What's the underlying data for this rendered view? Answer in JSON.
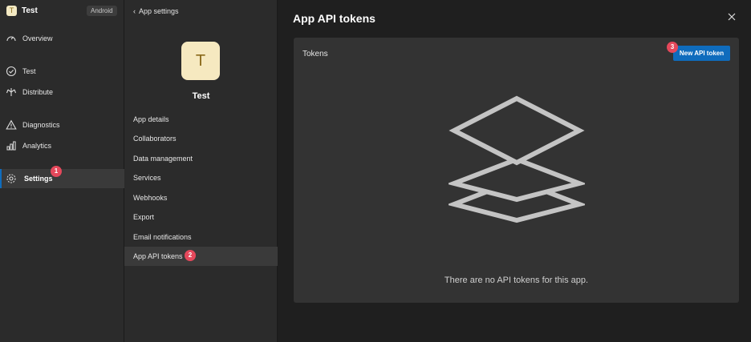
{
  "app": {
    "name": "Test",
    "initial": "T",
    "platform": "Android"
  },
  "nav": {
    "items": [
      {
        "label": "Overview",
        "icon": "gauge-icon"
      },
      {
        "label": "Test",
        "icon": "check-circle-icon"
      },
      {
        "label": "Distribute",
        "icon": "distribute-icon"
      },
      {
        "label": "Diagnostics",
        "icon": "warning-icon"
      },
      {
        "label": "Analytics",
        "icon": "bar-chart-icon"
      },
      {
        "label": "Settings",
        "icon": "gear-icon"
      }
    ],
    "active": "Settings"
  },
  "settings_column": {
    "back_label": "App settings",
    "app_title": "Test",
    "items": [
      "App details",
      "Collaborators",
      "Data management",
      "Services",
      "Webhooks",
      "Export",
      "Email notifications",
      "App API tokens"
    ],
    "active": "App API tokens"
  },
  "main": {
    "title": "App API tokens",
    "panel_title": "Tokens",
    "new_button_label": "New API token",
    "empty_message": "There are no API tokens for this app."
  },
  "steps": {
    "one": "1",
    "two": "2",
    "three": "3"
  },
  "colors": {
    "accent": "#0f6cbd",
    "badge": "#e5485b",
    "avatar_bg": "#f6e9c0"
  }
}
